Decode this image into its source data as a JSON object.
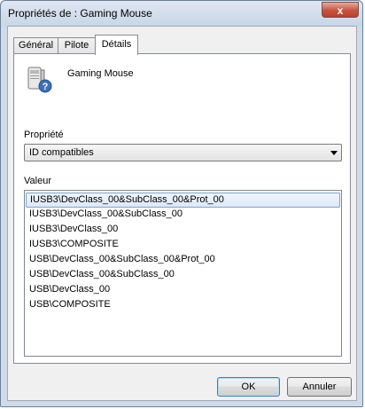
{
  "window": {
    "title": "Propriétés de : Gaming Mouse",
    "close_glyph": "x"
  },
  "tabs": [
    {
      "label": "Général"
    },
    {
      "label": "Pilote"
    },
    {
      "label": "Détails"
    }
  ],
  "active_tab": "Détails",
  "device": {
    "name": "Gaming Mouse",
    "icon": "mouse-device-question-icon"
  },
  "property": {
    "label": "Propriété",
    "selected": "ID compatibles"
  },
  "value": {
    "label": "Valeur",
    "items": [
      "IUSB3\\DevClass_00&SubClass_00&Prot_00",
      "IUSB3\\DevClass_00&SubClass_00",
      "IUSB3\\DevClass_00",
      "IUSB3\\COMPOSITE",
      "USB\\DevClass_00&SubClass_00&Prot_00",
      "USB\\DevClass_00&SubClass_00",
      "USB\\DevClass_00",
      "USB\\COMPOSITE"
    ],
    "selected_index": 0
  },
  "buttons": {
    "ok": "OK",
    "cancel": "Annuler"
  }
}
